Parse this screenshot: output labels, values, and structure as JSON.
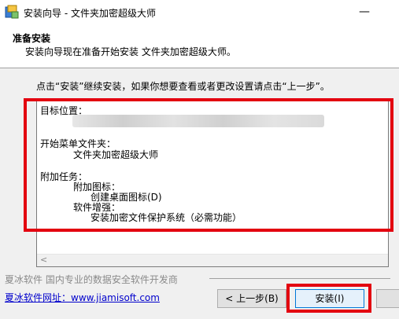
{
  "window": {
    "title": "安装向导 - 文件夹加密超级大师",
    "minimize_glyph": "—"
  },
  "header": {
    "title": "准备安装",
    "subtitle": "安装向导现在准备开始安装 文件夹加密超级大师。"
  },
  "instruction": "点击“安装”继续安装，如果你想要查看或者更改设置请点击“上一步”。",
  "memo": {
    "dest_label": "目标位置：",
    "start_menu_label": "开始菜单文件夹：",
    "start_menu_value": "文件夹加密超级大师",
    "tasks_label": "附加任务：",
    "icons_label": "附加图标：",
    "icons_value": "创建桌面图标(D)",
    "enhance_label": "软件增强：",
    "enhance_value": "安装加密文件保护系统（必需功能）",
    "scroll_left_glyph": "<"
  },
  "footer": {
    "company": "夏冰软件  国内专业的数据安全软件开发商",
    "website": "夏冰软件网址：www.jiamisoft.com"
  },
  "buttons": {
    "back": "< 上一步(B)",
    "install": "安装(I)"
  },
  "colors": {
    "highlight": "#e3000f",
    "link": "#0000cc"
  }
}
